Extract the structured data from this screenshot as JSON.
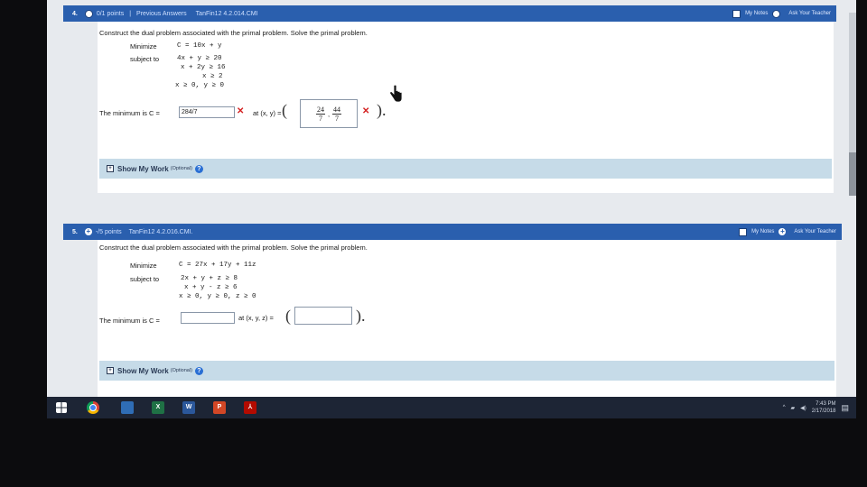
{
  "q4": {
    "num": "4.",
    "points": "0/1 points",
    "prev": "Previous Answers",
    "ref": "TanFin12 4.2.014.CMI",
    "notes": "My Notes",
    "ask": "Ask Your Teacher",
    "instruction": "Construct the dual problem associated with the primal problem. Solve the primal problem.",
    "minimize_label": "Minimize",
    "objective": "C = 10x + y",
    "subject_label": "subject to",
    "constraints": [
      "4x +   y ≥ 20",
      "x + 2y ≥ 16",
      "x ≥  2",
      "x ≥ 0, y ≥ 0"
    ],
    "minimum_text": "The minimum is C =",
    "min_value": "284/7",
    "at_text": "at (x, y) =",
    "x_num": "24",
    "x_den": "7",
    "y_num": "44",
    "y_den": "7",
    "show_work": "Show My Work",
    "optional": "(Optional)"
  },
  "q5": {
    "num": "5.",
    "points": "-/5 points",
    "ref": "TanFin12 4.2.016.CMI.",
    "notes": "My Notes",
    "ask": "Ask Your Teacher",
    "instruction": "Construct the dual problem associated with the primal problem. Solve the primal problem.",
    "minimize_label": "Minimize",
    "objective": "C = 27x + 17y + 11z",
    "subject_label": "subject to",
    "constraints": [
      "2x +  y +  z ≥ 8",
      "x +  y -  z ≥ 6",
      "x ≥ 0, y ≥ 0, z ≥ 0"
    ],
    "minimum_text": "The minimum is C =",
    "at_text": "at (x, y, z) =",
    "show_work": "Show My Work",
    "optional": "(Optional)"
  },
  "taskbar": {
    "time": "7:43 PM",
    "date": "2/17/2018",
    "icons": [
      "windows-start",
      "chrome",
      "file-explorer",
      "excel",
      "word",
      "powerpoint",
      "acrobat"
    ]
  },
  "colors": {
    "header": "#2a5fae",
    "workbar": "#c6dbe8",
    "error": "#d42020"
  }
}
